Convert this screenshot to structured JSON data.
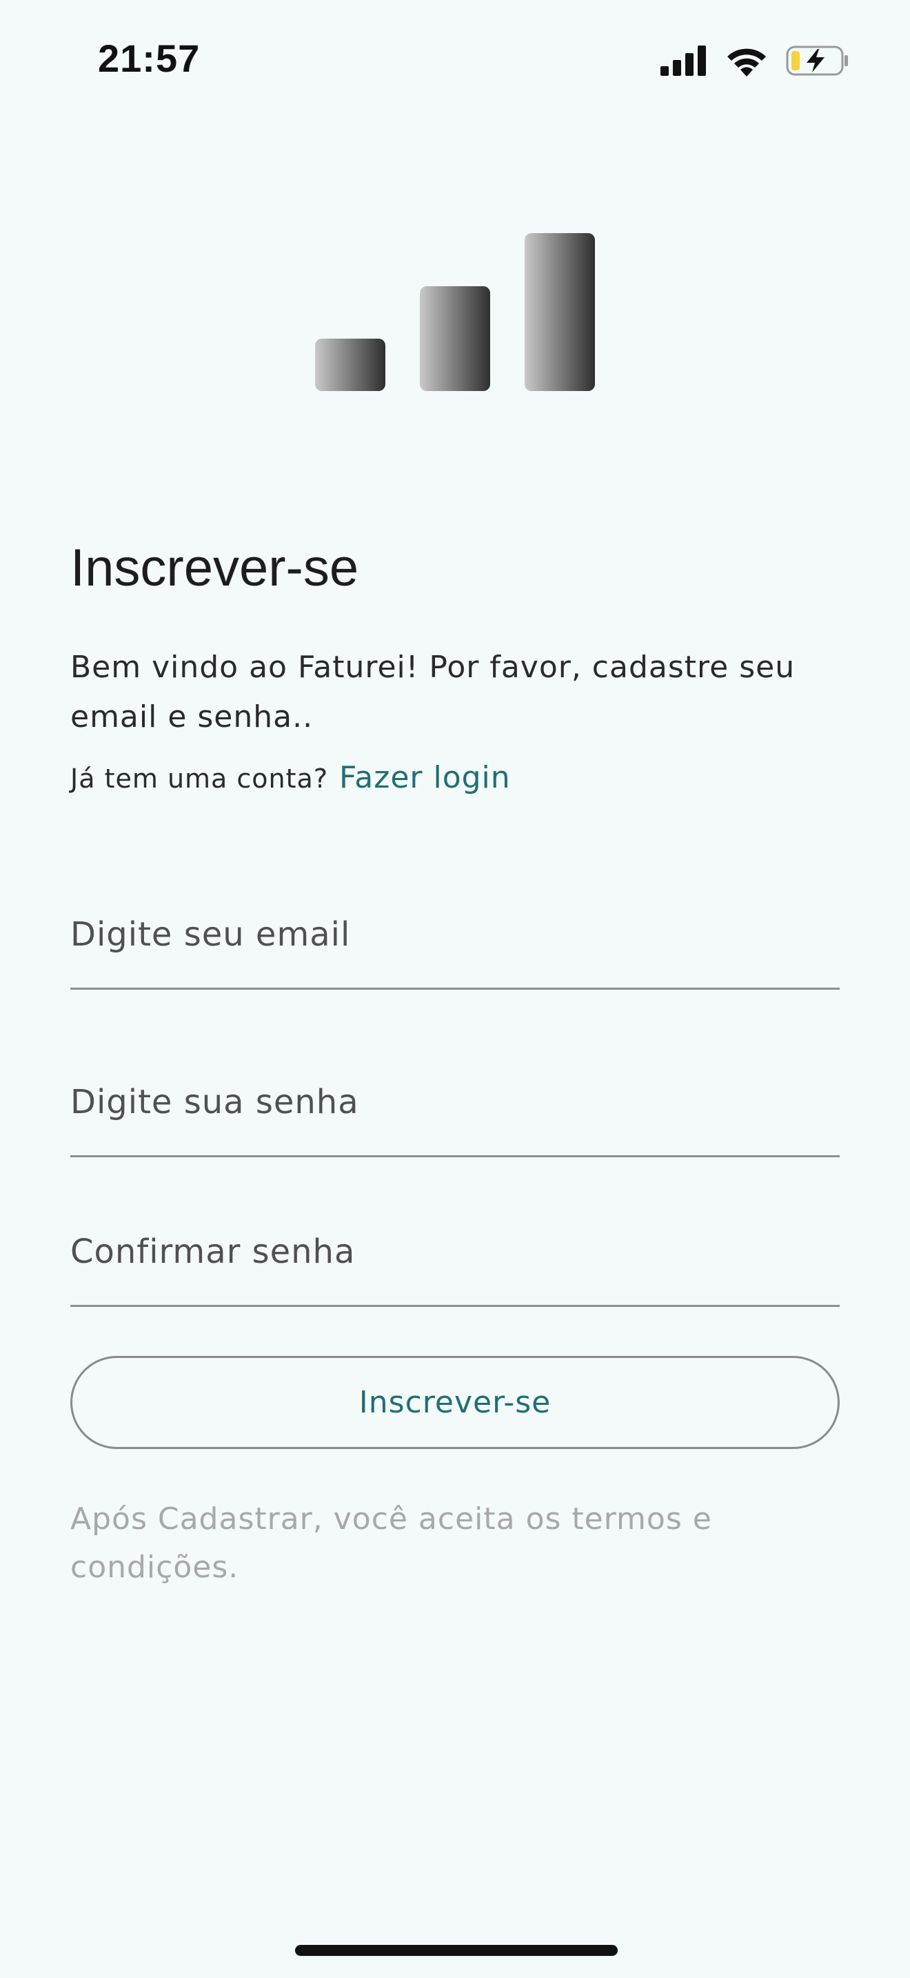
{
  "status_bar": {
    "time": "21:57",
    "icons": [
      "cellular-signal-icon",
      "wifi-icon",
      "battery-charging-icon"
    ],
    "battery_color": "#f5d33b"
  },
  "logo": {
    "icon": "bar-chart-logo-icon"
  },
  "signup": {
    "title": "Inscrever-se",
    "welcome": "Bem vindo ao Faturei! Por favor, cadastre seu email e senha..",
    "has_account": "Já tem uma conta?",
    "login_link": "Fazer login",
    "email_placeholder": "Digite seu email",
    "email_value": "",
    "password_placeholder": "Digite sua senha",
    "password_value": "",
    "confirm_placeholder": "Confirmar senha",
    "confirm_value": "",
    "submit_label": "Inscrever-se",
    "terms": "Após Cadastrar, você aceita os termos e condições."
  },
  "colors": {
    "accent": "#1f6f72",
    "background": "#f4f9f9",
    "muted_text": "#a8a8a8"
  }
}
